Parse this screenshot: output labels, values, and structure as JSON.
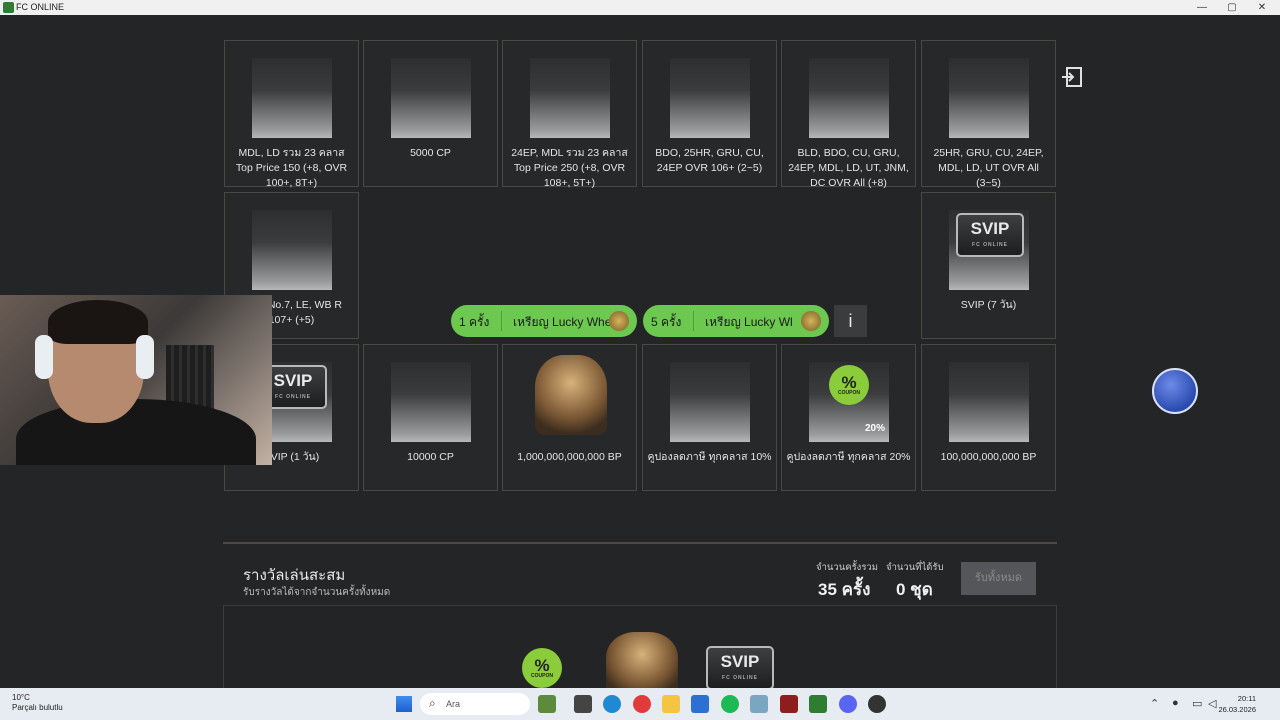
{
  "window": {
    "title": "FC ONLINE",
    "controls": [
      "—",
      "▢",
      "✕"
    ]
  },
  "cards": [
    {
      "label": "MDL, LD รวม 23 คลาส Top Price 150 (+8, OVR 100+, 8T+)",
      "type": "thumb"
    },
    {
      "label": "5000 CP",
      "type": "thumb"
    },
    {
      "label": "24EP, MDL รวม 23 คลาส Top Price 250 (+8, OVR 108+, 5T+)",
      "type": "thumb"
    },
    {
      "label": "BDO, 25HR, GRU, CU, 24EP OVR 106+ (2~5)",
      "type": "thumb"
    },
    {
      "label": "BLD, BDO, CU, GRU, 24EP, MDL, LD, UT, JNM, DC OVR All (+8)",
      "type": "thumb"
    },
    {
      "label": "25HR, GRU, CU, 24EP, MDL, LD, UT OVR All (3~5)",
      "type": "thumb"
    },
    {
      "label": ", CH, No.7, LE, WB R 107+ (+5)",
      "type": "thumb"
    },
    {
      "label": "SVIP (7 วัน)",
      "type": "svip"
    },
    {
      "label": "SVIP (1 วัน)",
      "type": "svip"
    },
    {
      "label": "10000 CP",
      "type": "thumb"
    },
    {
      "label": "1,000,000,000,000 BP",
      "type": "coins"
    },
    {
      "label": "คูปองลดภาษี ทุกคลาส 10%",
      "type": "thumb"
    },
    {
      "label": "คูปองลดภาษี ทุกคลาส 20%",
      "type": "coupon"
    },
    {
      "label": "100,000,000,000 BP",
      "type": "thumb"
    }
  ],
  "svip_text": {
    "logo": "SVIP",
    "sub": "FC ONLINE"
  },
  "coupon_text": {
    "symbol": "%",
    "sub": "COUPON",
    "pct": "20%"
  },
  "spin": {
    "one": {
      "count": "1 ครั้ง",
      "label": "เหรียญ Lucky Whe"
    },
    "five": {
      "count": "5 ครั้ง",
      "label": "เหรียญ Lucky Wl"
    },
    "info": "i"
  },
  "rewards": {
    "title": "รางวัลเล่นสะสม",
    "subtitle": "รับรางวัลได้จากจำนวนครั้งทั้งหมด",
    "total_label": "จำนวนครั้งรวม",
    "total_value": "35 ครั้ง",
    "received_label": "จำนวนที่ได้รับ",
    "received_value": "0 ชุด",
    "claim_all": "รับทั้งหมด"
  },
  "taskbar": {
    "weather_temp": "10°C",
    "weather_desc": "Parçalı bulutlu",
    "search_placeholder": "Ara",
    "time": "20:11",
    "date": "26.03.2026"
  },
  "colors": {
    "accent_green": "#6cc84f",
    "background": "#242527",
    "card_border": "#4a4845"
  }
}
